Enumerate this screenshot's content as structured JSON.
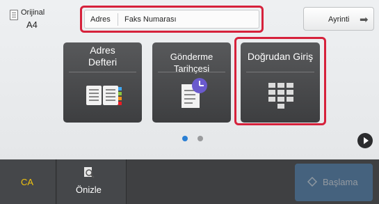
{
  "original": {
    "label": "Orijinal",
    "size": "A4"
  },
  "address_field": {
    "key": "Adres",
    "value": "Faks Numarası"
  },
  "detail_button": {
    "label": "Ayrinti"
  },
  "tiles": [
    {
      "label_line1": "Adres",
      "label_line2": "Defteri",
      "icon": "address-book-icon"
    },
    {
      "label": "Gönderme Tarihçesi",
      "icon": "send-history-icon"
    },
    {
      "label": "Doğrudan Giriş",
      "icon": "keypad-icon"
    }
  ],
  "pager": {
    "active_dot_color": "#2a7fd4",
    "inactive_dot_color": "#9a9b9d"
  },
  "bottom_bar": {
    "ca_label": "CA",
    "preview_label": "Önizle",
    "start_label": "Başlama"
  },
  "colors": {
    "highlight": "#d6213b",
    "tile": "#48494b",
    "ca_text": "#f1c40f",
    "start": "#4a7fb0"
  }
}
